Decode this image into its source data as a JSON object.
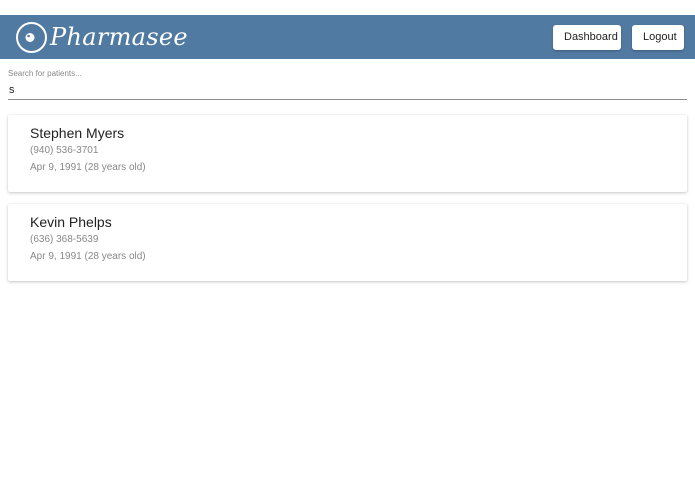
{
  "header": {
    "brand": "Pharmasee",
    "logo_icon": "eye-logo-icon",
    "dashboard_label": "Dashboard",
    "logout_label": "Logout",
    "color": "#517aa2"
  },
  "search": {
    "placeholder": "Search for patients...",
    "value": "s"
  },
  "patients": [
    {
      "name": "Stephen Myers",
      "phone": "(940) 536-3701",
      "dob": "Apr 9, 1991 (28 years old)"
    },
    {
      "name": "Kevin Phelps",
      "phone": "(636) 368-5639",
      "dob": "Apr 9, 1991 (28 years old)"
    }
  ]
}
